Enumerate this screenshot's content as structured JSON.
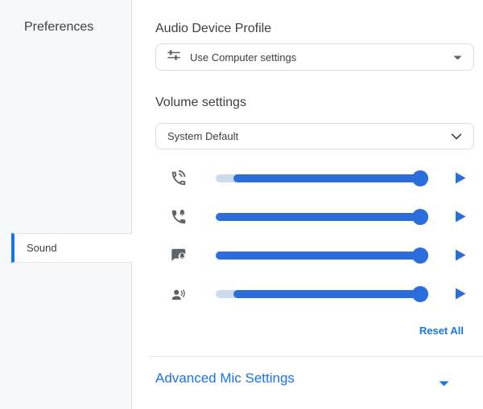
{
  "colors": {
    "accent_blue": "#1a73e8",
    "slider_blue": "#2b6edb",
    "slider_track_light": "#ccdcec",
    "icon_gray": "#5f6368",
    "text_dark": "#3c4043",
    "border_gray": "#dadce0",
    "sidebar_bg": "#f7f8f9"
  },
  "sidebar": {
    "title": "Preferences",
    "items": [
      {
        "label": "Sound",
        "selected": true
      }
    ]
  },
  "audio_profile": {
    "heading": "Audio Device Profile",
    "selected_value": "Use Computer settings",
    "icon": "tune-icon",
    "arrow": "dropdown-arrow-filled"
  },
  "volume": {
    "heading": "Volume settings",
    "output_device": {
      "selected_value": "System Default",
      "arrow": "chevron-down"
    },
    "sliders": [
      {
        "id": "call-speaker",
        "icon": "phone-in-talk-icon",
        "value_pct": 100,
        "fill_start_pct": 8.5,
        "has_play_button": true
      },
      {
        "id": "ringtone",
        "icon": "phone-bell-icon",
        "value_pct": 100,
        "fill_start_pct": 0,
        "has_play_button": true
      },
      {
        "id": "message-alert",
        "icon": "chat-alert-icon",
        "value_pct": 100,
        "fill_start_pct": 0,
        "has_play_button": true
      },
      {
        "id": "voice",
        "icon": "person-voice-icon",
        "value_pct": 100,
        "fill_start_pct": 8.5,
        "has_play_button": true
      }
    ],
    "reset_label": "Reset All"
  },
  "advanced": {
    "label": "Advanced Mic Settings"
  }
}
